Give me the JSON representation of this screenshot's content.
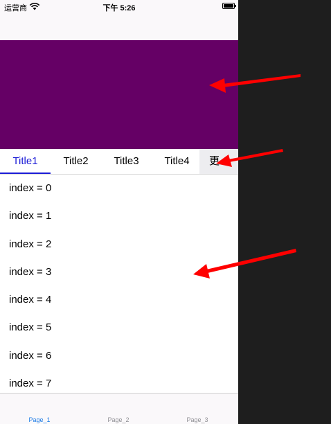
{
  "status": {
    "carrier": "运营商",
    "time": "下午 5:26"
  },
  "tabs": [
    {
      "label": "Title1",
      "active": true
    },
    {
      "label": "Title2",
      "active": false
    },
    {
      "label": "Title3",
      "active": false
    },
    {
      "label": "Title4",
      "active": false
    }
  ],
  "more_label": "更",
  "list": [
    "index = 0",
    "index = 1",
    "index = 2",
    "index = 3",
    "index = 4",
    "index = 5",
    "index = 6",
    "index = 7"
  ],
  "tabbar": [
    {
      "label": "Page_1",
      "active": true
    },
    {
      "label": "Page_2",
      "active": false
    },
    {
      "label": "Page_3",
      "active": false
    }
  ],
  "colors": {
    "banner": "#650065",
    "accent": "#1a1ad6",
    "tabbar_active": "#1a7ae6",
    "annotation_arrow": "#ff0000",
    "backdrop": "#1e1e1e"
  }
}
